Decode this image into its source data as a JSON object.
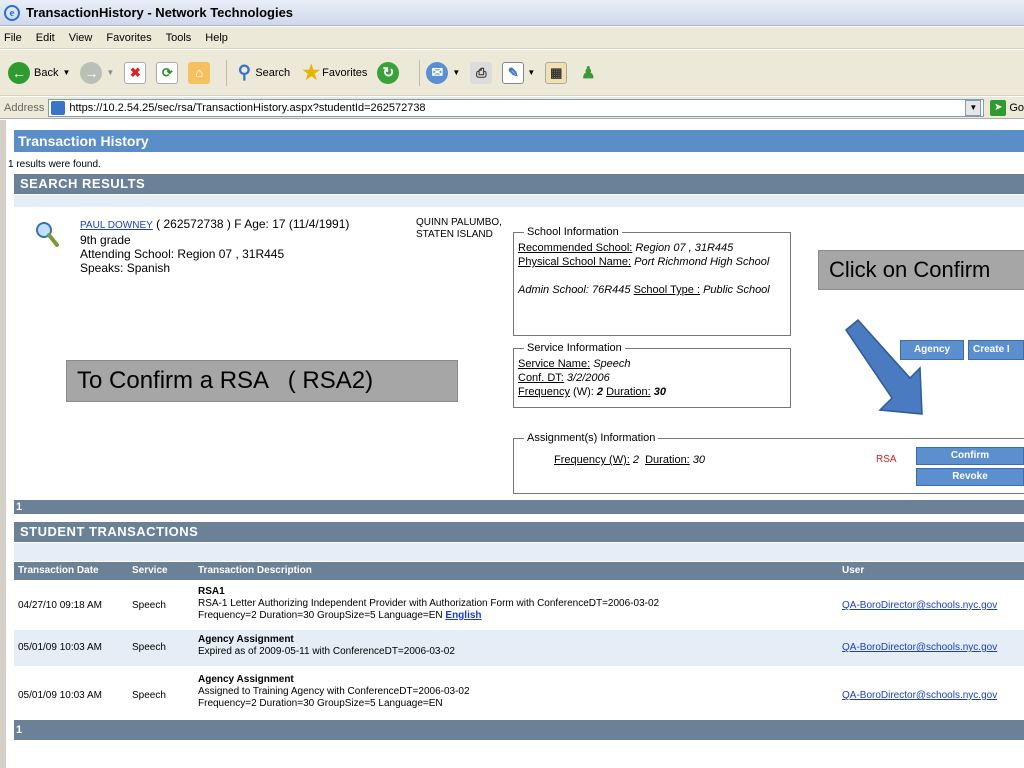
{
  "window": {
    "title": "TransactionHistory - Network Technologies"
  },
  "menu": [
    "File",
    "Edit",
    "View",
    "Favorites",
    "Tools",
    "Help"
  ],
  "toolbar": {
    "back": "Back",
    "search": "Search",
    "favorites": "Favorites"
  },
  "address": {
    "label": "Address",
    "url": "https://10.2.54.25/sec/rsa/TransactionHistory.aspx?studentId=262572738",
    "go": "Go"
  },
  "page": {
    "title": "Transaction History",
    "results_found": "1 results were found.",
    "search_results_header": "SEARCH RESULTS",
    "student": {
      "name": "PAUL DOWNEY",
      "details": "( 262572738 )  F Age: 17 (11/4/1991)",
      "grade": "9th grade",
      "attending": "Attending School: Region 07 , 31R445",
      "speaks": "Speaks: Spanish",
      "cm_line1": "QUINN  PALUMBO,",
      "cm_line2": "STATEN ISLAND"
    },
    "school_info": {
      "legend": "School Information",
      "recommended_label": "Recommended School:",
      "recommended_value": "Region 07 , 31R445",
      "physical_label": "Physical School Name:",
      "physical_value": "Port Richmond High School",
      "admin": "Admin School: 76R445",
      "type_label": "School Type :",
      "type_value": "Public School"
    },
    "service_info": {
      "legend": "Service Information",
      "name_label": "Service Name:",
      "name_value": "Speech",
      "conf_label": "Conf. DT:",
      "conf_value": "3/2/2006",
      "freq_label": "Frequency",
      "freq_w": "(W):",
      "freq_value": "2",
      "dur_label": "Duration:",
      "dur_value": "30"
    },
    "assignment_info": {
      "legend": "Assignment(s) Information",
      "freq_label": "Frequency (W):",
      "freq_value": "2",
      "dur_label": "Duration:",
      "dur_value": "30"
    },
    "callouts": {
      "confirm_rsa": "To Confirm a RSA   ( RSA2)",
      "click_confirm": "Click on Confirm"
    },
    "buttons": {
      "agency": "Agency",
      "create": "Create I",
      "rsa_label": "RSA",
      "confirm": "Confirm",
      "revoke": "Revoke"
    },
    "pager_top": "1",
    "student_transactions_header": "STUDENT TRANSACTIONS",
    "table": {
      "headers": [
        "Transaction Date",
        "Service",
        "Transaction Description",
        "User"
      ],
      "rows": [
        {
          "date": "04/27/10 09:18 AM",
          "service": "Speech",
          "title": "RSA1",
          "line1": "RSA-1 Letter Authorizing Independent Provider with Authorization Form with ConferenceDT=2006-03-02",
          "line2": "Frequency=2 Duration=30 GroupSize=5 Language=EN",
          "link": "English",
          "user": "QA-BoroDirector@schools.nyc.gov"
        },
        {
          "date": "05/01/09 10:03 AM",
          "service": "Speech",
          "title": "Agency Assignment",
          "line1": "Expired as of 2009-05-11 with ConferenceDT=2006-03-02",
          "line2": "",
          "link": "",
          "user": "QA-BoroDirector@schools.nyc.gov"
        },
        {
          "date": "05/01/09 10:03 AM",
          "service": "Speech",
          "title": "Agency Assignment",
          "line1": "Assigned to Training Agency with ConferenceDT=2006-03-02",
          "line2": "Frequency=2 Duration=30 GroupSize=5 Language=EN",
          "link": "",
          "user": "QA-BoroDirector@schools.nyc.gov"
        }
      ]
    },
    "pager_bottom": "1"
  }
}
